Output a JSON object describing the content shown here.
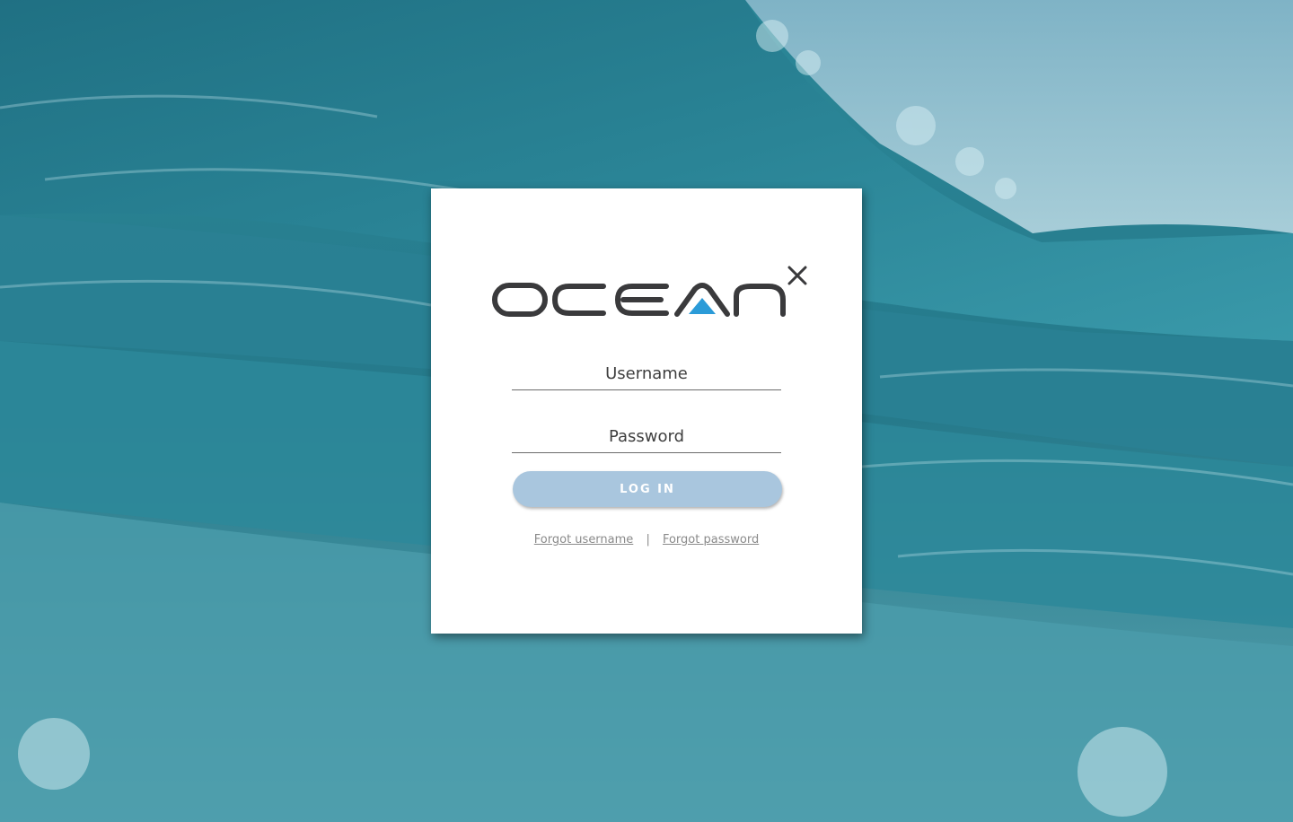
{
  "brand": {
    "logo_text": "OCEAN",
    "logo_superscript": "X",
    "logo_color": "#3a3a3c",
    "accent_color": "#2b9bd8"
  },
  "form": {
    "username_placeholder": "Username",
    "username_value": "",
    "password_placeholder": "Password",
    "password_value": "",
    "login_label": "LOG IN",
    "login_button_color": "#a9c6de"
  },
  "links": {
    "forgot_username": "Forgot username",
    "separator": "|",
    "forgot_password": "Forgot password"
  },
  "background": {
    "image_subject": "ocean-wave-photo",
    "primary_color": "#2a7f8f"
  }
}
